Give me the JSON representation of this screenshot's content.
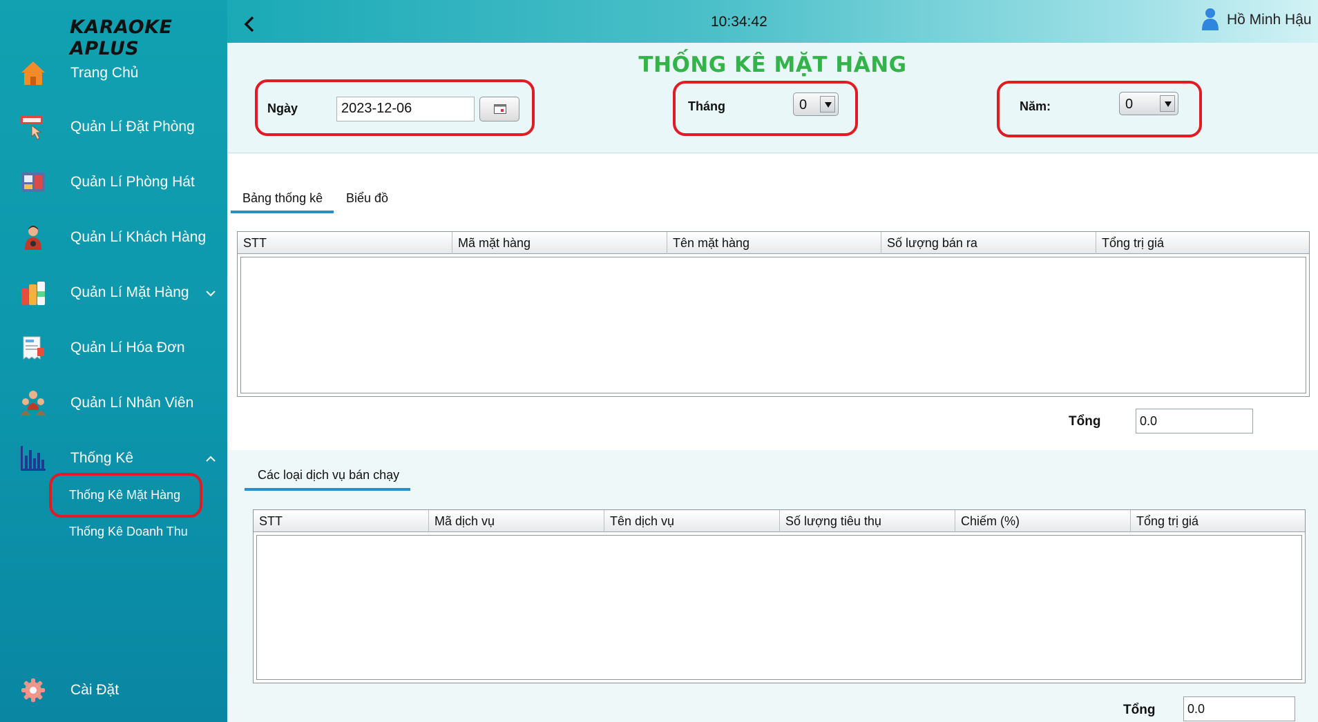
{
  "app": {
    "brand": "KARAOKE APLUS"
  },
  "topbar": {
    "clock": "10:34:42",
    "user_name": "Hồ Minh Hậu"
  },
  "sidebar": {
    "items": [
      {
        "label": "Trang Chủ",
        "icon": "home-icon"
      },
      {
        "label": "Quản Lí Đặt Phòng",
        "icon": "booking-icon"
      },
      {
        "label": "Quản Lí Phòng Hát",
        "icon": "karaoke-room-icon"
      },
      {
        "label": "Quản Lí Khách Hàng",
        "icon": "customer-icon"
      },
      {
        "label": "Quản Lí Mặt Hàng",
        "icon": "products-icon"
      },
      {
        "label": "Quản Lí Hóa Đơn",
        "icon": "invoice-icon"
      },
      {
        "label": "Quản Lí Nhân Viên",
        "icon": "staff-icon"
      },
      {
        "label": "Thống Kê",
        "icon": "statistics-icon"
      }
    ],
    "sub_items": [
      "Thống Kê Mặt Hàng",
      "Thống Kê Doanh Thu"
    ],
    "settings": {
      "label": "Cài Đặt",
      "icon": "settings-gear-icon"
    }
  },
  "page": {
    "title": "THỐNG KÊ MẶT HÀNG"
  },
  "filters": {
    "date_label": "Ngày",
    "date_value": "2023-12-06",
    "month_label": "Tháng",
    "month_value": "0",
    "year_label": "Năm:",
    "year_value": "0"
  },
  "tabs": [
    "Bảng thống kê",
    "Biểu đồ"
  ],
  "product_table": {
    "columns": [
      "STT",
      "Mã mặt hàng",
      "Tên mặt hàng",
      "Số lượng bán ra",
      "Tổng trị giá"
    ],
    "rows": []
  },
  "product_total": {
    "label": "Tổng",
    "value": "0.0"
  },
  "service_section": {
    "tab": "Các loại dịch vụ bán chạy",
    "columns": [
      "STT",
      "Mã dịch vụ",
      "Tên dịch vụ",
      "Số lượng tiêu thụ",
      "Chiếm (%)",
      "Tổng trị giá"
    ],
    "rows": []
  },
  "service_total": {
    "label": "Tổng",
    "value": "0.0"
  },
  "colors": {
    "accent_title": "#34b34a",
    "sidebar": "#0d97ad",
    "highlight_ring": "#e01b24",
    "tab_underline": "#2a8fc8"
  }
}
